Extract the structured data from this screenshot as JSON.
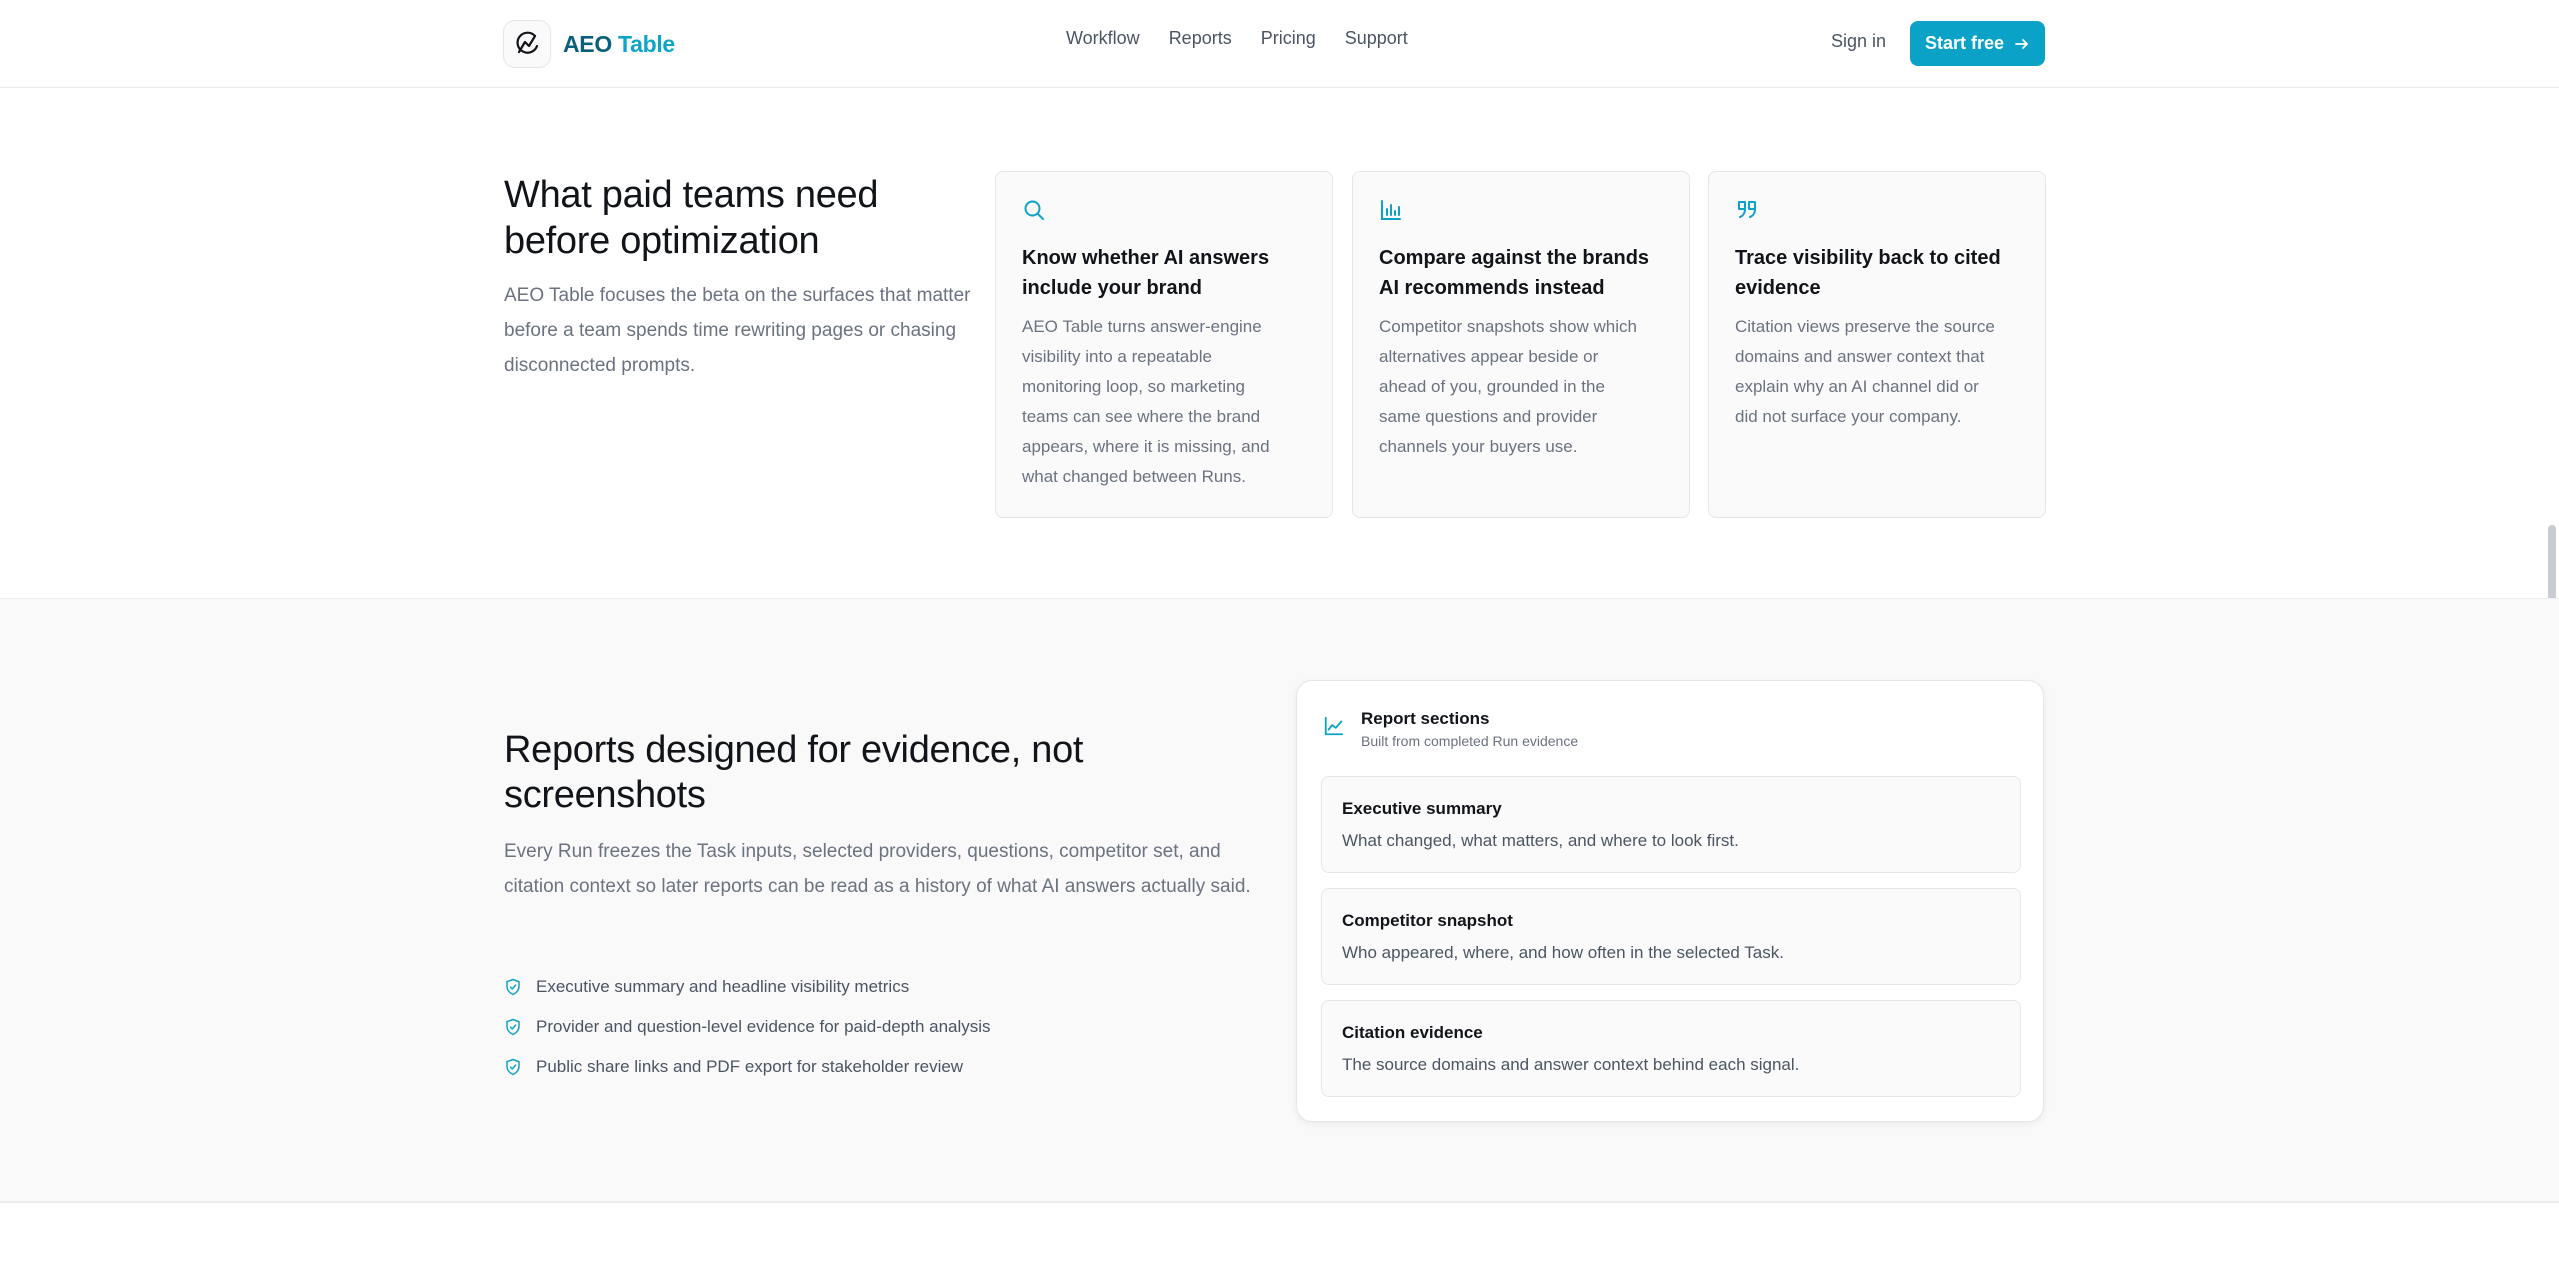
{
  "header": {
    "logo_text_1": "AEO ",
    "logo_text_2": "Table",
    "nav": [
      "Workflow",
      "Reports",
      "Pricing",
      "Support"
    ],
    "sign_in": "Sign in",
    "start_free": "Start free"
  },
  "section1": {
    "title": "What paid teams need before optimization",
    "description": "AEO Table focuses the beta on the surfaces that matter before a team spends time rewriting pages or chasing disconnected prompts.",
    "cards": [
      {
        "icon": "search-icon",
        "title": "Know whether AI answers include your brand",
        "body": "AEO Table turns answer-engine visibility into a repeatable monitoring loop, so marketing teams can see where the brand appears, where it is missing, and what changed between Runs."
      },
      {
        "icon": "bar-chart-icon",
        "title": "Compare against the brands AI recommends instead",
        "body": "Competitor snapshots show which alternatives appear beside or ahead of you, grounded in the same questions and provider channels your buyers use."
      },
      {
        "icon": "quote-icon",
        "title": "Trace visibility back to cited evidence",
        "body": "Citation views preserve the source domains and answer context that explain why an AI channel did or did not surface your company."
      }
    ]
  },
  "section2": {
    "title": "Reports designed for evidence, not screenshots",
    "description": "Every Run freezes the Task inputs, selected providers, questions, competitor set, and citation context so later reports can be read as a history of what AI answers actually said.",
    "checks": [
      "Executive summary and headline visibility metrics",
      "Provider and question-level evidence for paid-depth analysis",
      "Public share links and PDF export for stakeholder review"
    ],
    "panel": {
      "title": "Report sections",
      "subtitle": "Built from completed Run evidence",
      "items": [
        {
          "title": "Executive summary",
          "desc": "What changed, what matters, and where to look first."
        },
        {
          "title": "Competitor snapshot",
          "desc": "Who appeared, where, and how often in the selected Task."
        },
        {
          "title": "Citation evidence",
          "desc": "The source domains and answer context behind each signal."
        }
      ]
    }
  },
  "colors": {
    "accent": "#0aa3c7",
    "brand_dark": "#0a5f7a"
  }
}
